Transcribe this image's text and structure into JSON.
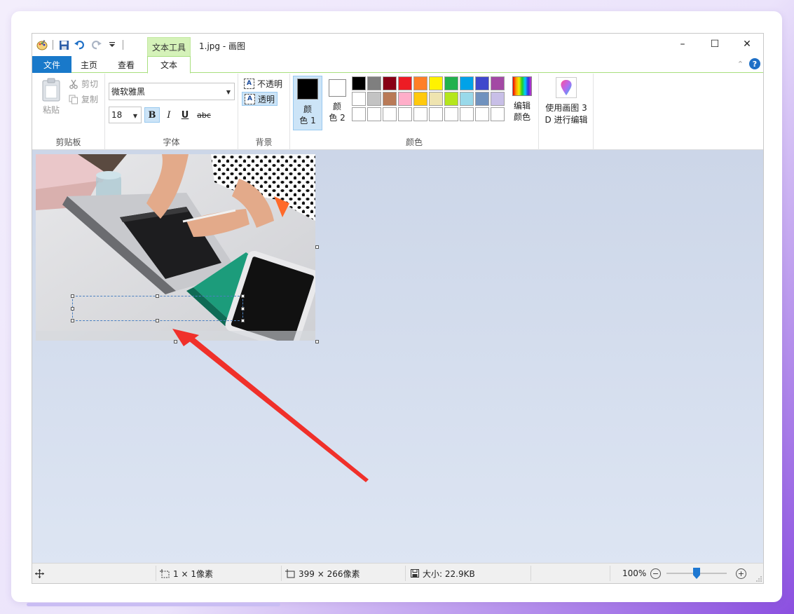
{
  "window": {
    "context_tab": "文本工具",
    "title": "1.jpg - 画图",
    "controls": [
      "–",
      "☐",
      "✕"
    ]
  },
  "tabs": {
    "file": "文件",
    "home": "主页",
    "view": "查看",
    "text": "文本"
  },
  "ribbon": {
    "clipboard": {
      "label": "剪贴板",
      "paste": "粘贴",
      "cut": "剪切",
      "copy": "复制"
    },
    "font": {
      "label": "字体",
      "family": "微软雅黑",
      "size": "18",
      "bold": "B",
      "italic": "I",
      "underline": "U",
      "strike": "abc"
    },
    "background": {
      "label": "背景",
      "opaque": "不透明",
      "transparent": "透明"
    },
    "colors": {
      "label": "颜色",
      "color1_line1": "颜",
      "color1_line2": "色 1",
      "color2_line1": "颜",
      "color2_line2": "色 2",
      "color1_value": "#000000",
      "color2_value": "#ffffff",
      "palette": [
        "#000000",
        "#7f7f7f",
        "#880015",
        "#ed1c24",
        "#ff7f27",
        "#fff200",
        "#22b14c",
        "#00a2e8",
        "#3f48cc",
        "#a349a4",
        "#ffffff",
        "#c3c3c3",
        "#b97a57",
        "#ffaec9",
        "#ffc90e",
        "#efe4b0",
        "#b5e61d",
        "#99d9ea",
        "#7092be",
        "#c8bfe7",
        "#ffffff",
        "#ffffff",
        "#ffffff",
        "#ffffff",
        "#ffffff",
        "#ffffff",
        "#ffffff",
        "#ffffff",
        "#ffffff",
        "#ffffff"
      ],
      "edit_line1": "编辑",
      "edit_line2": "颜色"
    },
    "paint3d": {
      "line1": "使用画图 3",
      "line2": "D 进行编辑"
    }
  },
  "status": {
    "selection": "1 × 1像素",
    "image_size": "399 × 266像素",
    "file_size": "大小: 22.9KB",
    "zoom": "100%",
    "zoom_fraction": 0.5
  },
  "colors": {
    "accent": "#1979ca",
    "context_green": "#d5f2b9",
    "annotation_arrow": "#f0302a"
  }
}
